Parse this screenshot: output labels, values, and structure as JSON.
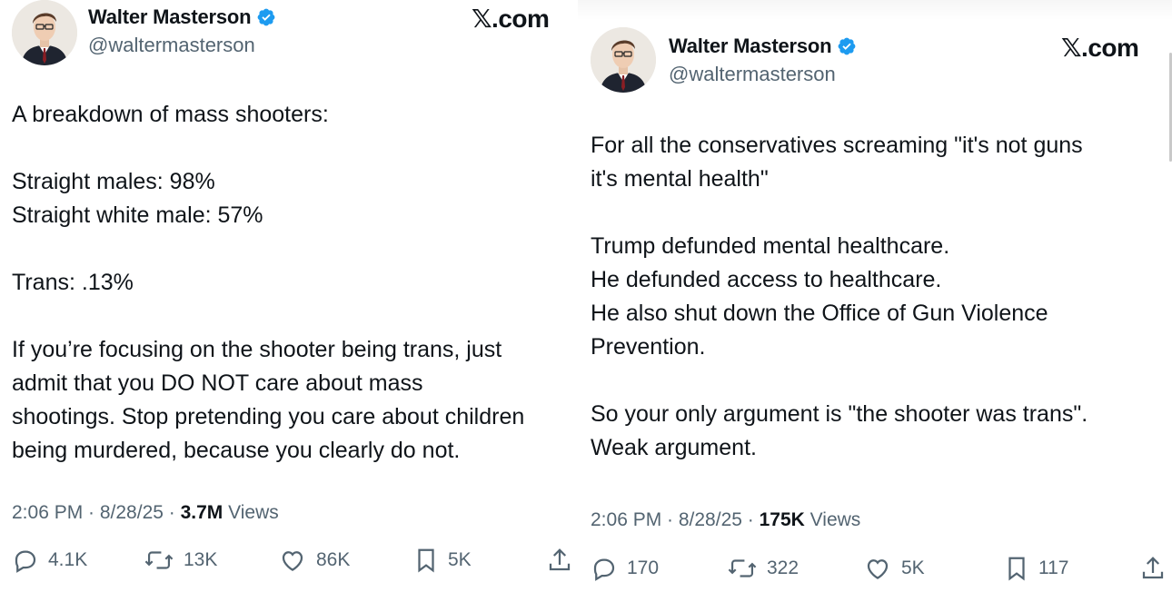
{
  "tweets": [
    {
      "author": {
        "display_name": "Walter Masterson",
        "handle": "@waltermasterson",
        "verified": true
      },
      "site_label": "𝕏.com",
      "text": "A breakdown of mass shooters:\n\nStraight males: 98%\nStraight white male: 57%\n\nTrans: .13%\n\nIf you’re focusing on the shooter being trans, just\nadmit that you DO NOT care about mass\nshootings. Stop pretending you care about children\nbeing murdered, because you clearly do not.",
      "timestamp": "2:06 PM · 8/28/25 · ",
      "views_count": "3.7M",
      "views_label": " Views",
      "actions": {
        "replies": "4.1K",
        "reposts": "13K",
        "likes": "86K",
        "bookmarks": "5K"
      }
    },
    {
      "author": {
        "display_name": "Walter Masterson",
        "handle": "@waltermasterson",
        "verified": true
      },
      "site_label": "𝕏.com",
      "text": "For all the conservatives screaming \"it's not guns\nit's mental health\"\n\nTrump defunded mental healthcare.\nHe defunded access to healthcare.\nHe also shut down the Office of Gun Violence\nPrevention.\n\nSo your only argument is \"the shooter was trans\".\nWeak argument.",
      "timestamp": "2:06 PM · 8/28/25 · ",
      "views_count": "175K",
      "views_label": " Views",
      "actions": {
        "replies": "170",
        "reposts": "322",
        "likes": "5K",
        "bookmarks": "117"
      }
    }
  ],
  "colors": {
    "text_primary": "#0f1419",
    "text_secondary": "#536471",
    "verified_blue": "#1d9bf0"
  },
  "icons": [
    "verified-badge-icon",
    "reply-icon",
    "repost-icon",
    "like-icon",
    "bookmark-icon",
    "share-icon"
  ]
}
